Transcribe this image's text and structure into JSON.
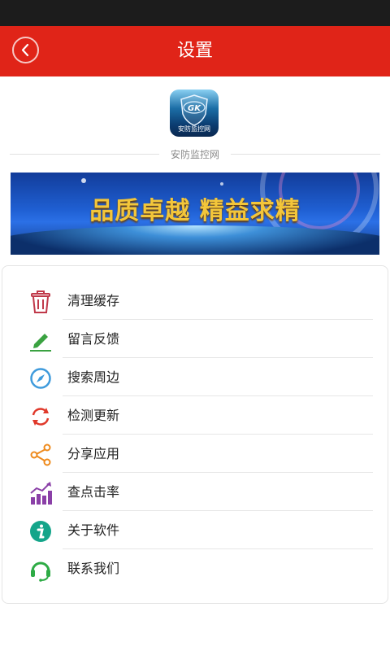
{
  "header": {
    "title": "设置"
  },
  "app": {
    "logo_text": "安防监控网",
    "site_name": "安防监控网"
  },
  "banner": {
    "slogan": "品质卓越 精益求精"
  },
  "menu": {
    "items": [
      {
        "label": "清理缓存",
        "icon": "trash-icon",
        "color": "#c0394a"
      },
      {
        "label": "留言反馈",
        "icon": "pencil-icon",
        "color": "#3aa241"
      },
      {
        "label": "搜索周边",
        "icon": "compass-icon",
        "color": "#3f9bdc"
      },
      {
        "label": "检测更新",
        "icon": "refresh-icon",
        "color": "#e0392b"
      },
      {
        "label": "分享应用",
        "icon": "share-icon",
        "color": "#ee8a1c"
      },
      {
        "label": "查点击率",
        "icon": "bar-chart-icon",
        "color": "#8a3fa7"
      },
      {
        "label": "关于软件",
        "icon": "info-icon",
        "color": "#14a58a"
      },
      {
        "label": "联系我们",
        "icon": "headset-icon",
        "color": "#2eab45"
      }
    ]
  },
  "colors": {
    "header_bg": "#e02418",
    "status_bar": "#1c1c1c"
  }
}
